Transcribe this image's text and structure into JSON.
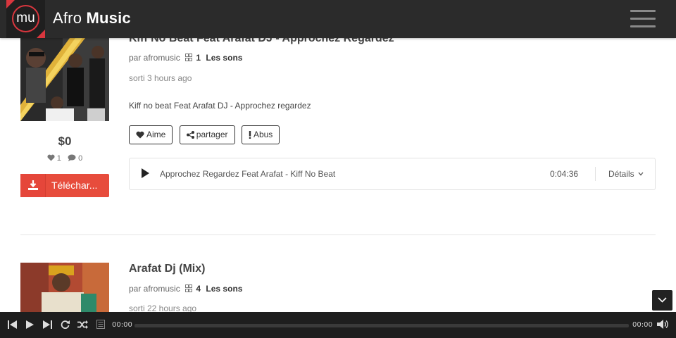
{
  "header": {
    "logo_text": "mu",
    "brand_light": "Afro",
    "brand_bold": "Music",
    "accent_color": "#d9363e"
  },
  "tracks": [
    {
      "title": "Kiff No Beat Feat Arafat DJ - Approchez Regardez",
      "by": "par afromusic",
      "count": "1",
      "sons_label": "Les sons",
      "released": "sorti 3 hours ago",
      "description": "Kiff no beat Feat Arafat DJ - Approchez regardez",
      "buttons": {
        "like": "Aime",
        "share": "partager",
        "report": "Abus"
      },
      "player": {
        "title": "Approchez Regardez Feat Arafat - Kiff No Beat",
        "duration": "0:04:36",
        "details": "Détails"
      },
      "price": "$0",
      "likes": "1",
      "comments": "0",
      "download_label": "Téléchar..."
    },
    {
      "title": "Arafat Dj (Mix)",
      "by": "par afromusic",
      "count": "4",
      "sons_label": "Les sons",
      "released": "sorti 22 hours ago"
    }
  ],
  "audio_bar": {
    "current_time": "00:00",
    "total_time": "00:00",
    "progress_fraction": 0,
    "icons": [
      "previous-icon",
      "play-icon",
      "next-icon",
      "repeat-icon",
      "shuffle-icon",
      "playlist-icon",
      "volume-icon"
    ]
  },
  "colors": {
    "download_button": "#e74c3c",
    "navbar": "#2b2b2b",
    "audio_bar": "#1e1e1e"
  }
}
